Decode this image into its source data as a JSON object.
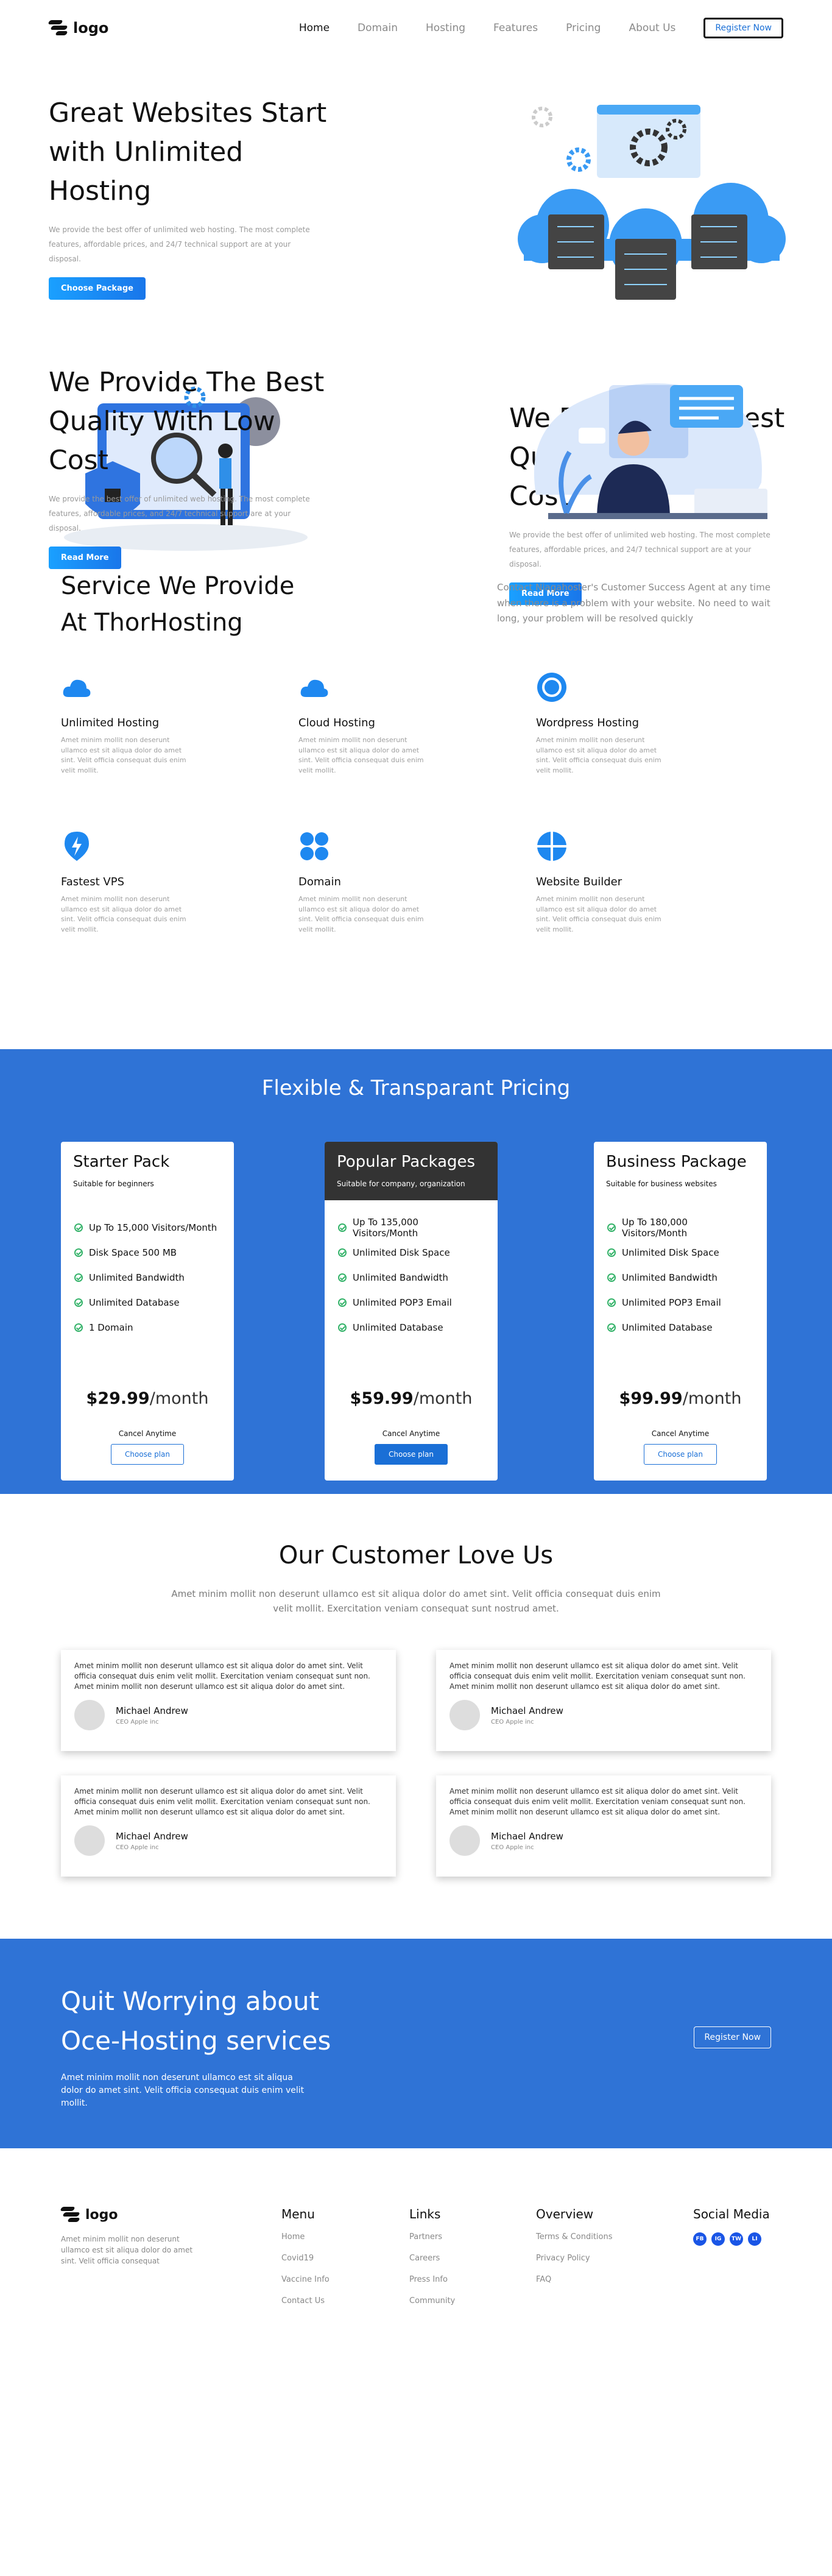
{
  "brand": {
    "logo_text": "logo",
    "accent": "#1a6fd6",
    "primary_blue": "#2f73d6"
  },
  "nav": {
    "items": [
      "Home",
      "Domain",
      "Hosting",
      "Features",
      "Pricing",
      "About Us"
    ],
    "register_label": "Register Now"
  },
  "hero": {
    "title": "Great Websites Start with Unlimited Hosting",
    "text": "We provide the best offer of unlimited web hosting. The most complete features, affordable prices, and 24/7 technical support are at your disposal.",
    "button": "Choose Package"
  },
  "quality1": {
    "title": "We Provide The Best Quality With Low Cost",
    "text": "We provide the best offer of unlimited web hosting. The most complete features, affordable prices, and 24/7 technical support are at your disposal.",
    "button": "Read More"
  },
  "quality2": {
    "title": "We Provide The Best Quality With Low Cost",
    "text": "We provide the best offer of unlimited web hosting. The most complete features, affordable prices, and 24/7 technical support are at your disposal.",
    "button": "Read More"
  },
  "services": {
    "title": "Service We Provide At ThorHosting",
    "subtitle": "Contact Niagahoster's Customer Success Agent at any time when there is a problem with your website. No need to wait long, your problem will be resolved quickly",
    "items": [
      {
        "name": "Unlimited Hosting",
        "icon": "cloud-icon",
        "text": "Amet minim mollit non deserunt ullamco est sit aliqua dolor do amet sint. Velit officia consequat duis enim velit mollit."
      },
      {
        "name": "Cloud Hosting",
        "icon": "cloud-icon",
        "text": "Amet minim mollit non deserunt ullamco est sit aliqua dolor do amet sint. Velit officia consequat duis enim velit mollit."
      },
      {
        "name": "Wordpress Hosting",
        "icon": "wordpress-icon",
        "text": "Amet minim mollit non deserunt ullamco est sit aliqua dolor do amet sint. Velit officia consequat duis enim velit mollit."
      },
      {
        "name": "Fastest VPS",
        "icon": "lightning-icon",
        "text": "Amet minim mollit non deserunt ullamco est sit aliqua dolor do amet sint. Velit officia consequat duis enim velit mollit."
      },
      {
        "name": "Domain",
        "icon": "grid-icon",
        "text": "Amet minim mollit non deserunt ullamco est sit aliqua dolor do amet sint. Velit officia consequat duis enim velit mollit."
      },
      {
        "name": "Website Builder",
        "icon": "pie-icon",
        "text": "Amet minim mollit non deserunt ullamco est sit aliqua dolor do amet sint. Velit officia consequat duis enim velit mollit."
      }
    ]
  },
  "pricing": {
    "title": "Flexible & Transparant Pricing",
    "plans": [
      {
        "name": "Starter Pack",
        "sub": "Suitable for beginners",
        "features": [
          "Up To 15,000 Visitors/Month",
          "Disk Space 500 MB",
          "Unlimited Bandwidth",
          "Unlimited Database",
          "1 Domain"
        ],
        "price": "$29.99",
        "period": "/month",
        "cancel": "Cancel Anytime",
        "button": "Choose plan"
      },
      {
        "name": "Popular Packages",
        "sub": "Suitable for company, organization",
        "features": [
          "Up To 135,000 Visitors/Month",
          "Unlimited Disk Space",
          "Unlimited Bandwidth",
          "Unlimited POP3 Email",
          "Unlimited Database"
        ],
        "price": "$59.99",
        "period": "/month",
        "cancel": "Cancel Anytime",
        "button": "Choose plan"
      },
      {
        "name": "Business Package",
        "sub": "Suitable for business websites",
        "features": [
          "Up To 180,000 Visitors/Month",
          "Unlimited Disk Space",
          "Unlimited Bandwidth",
          "Unlimited POP3 Email",
          "Unlimited Database"
        ],
        "price": "$99.99",
        "period": "/month",
        "cancel": "Cancel Anytime",
        "button": "Choose plan"
      }
    ]
  },
  "testimonials": {
    "title": "Our Customer Love Us",
    "subtitle": "Amet minim mollit non deserunt ullamco est sit aliqua dolor do amet sint. Velit officia consequat duis enim velit mollit. Exercitation veniam consequat sunt nostrud amet.",
    "items": [
      {
        "text": "Amet minim mollit non deserunt ullamco est sit aliqua dolor do amet sint. Velit officia consequat duis enim velit mollit. Exercitation veniam consequat sunt non. Amet minim mollit non deserunt ullamco est sit aliqua dolor do amet sint.",
        "name": "Michael Andrew",
        "role": "CEO Apple inc"
      },
      {
        "text": "Amet minim mollit non deserunt ullamco est sit aliqua dolor do amet sint. Velit officia consequat duis enim velit mollit. Exercitation veniam consequat sunt non. Amet minim mollit non deserunt ullamco est sit aliqua dolor do amet sint.",
        "name": "Michael Andrew",
        "role": "CEO Apple inc"
      },
      {
        "text": "Amet minim mollit non deserunt ullamco est sit aliqua dolor do amet sint. Velit officia consequat duis enim velit mollit. Exercitation veniam consequat sunt non. Amet minim mollit non deserunt ullamco est sit aliqua dolor do amet sint.",
        "name": "Michael Andrew",
        "role": "CEO Apple inc"
      },
      {
        "text": "Amet minim mollit non deserunt ullamco est sit aliqua dolor do amet sint. Velit officia consequat duis enim velit mollit. Exercitation veniam consequat sunt non. Amet minim mollit non deserunt ullamco est sit aliqua dolor do amet sint.",
        "name": "Michael Andrew",
        "role": "CEO Apple inc"
      }
    ]
  },
  "cta": {
    "title": "Quit Worrying about Oce-Hosting services",
    "text": "Amet minim mollit non deserunt ullamco est sit aliqua dolor do amet sint. Velit officia consequat duis enim velit mollit.",
    "button": "Register Now"
  },
  "footer": {
    "logo_text": "logo",
    "about": "Amet minim mollit non deserunt ullamco est sit aliqua dolor do amet sint. Velit officia consequat",
    "menu_title": "Menu",
    "menu": [
      "Home",
      "Covid19",
      "Vaccine Info",
      "Contact Us"
    ],
    "links_title": "Links",
    "links": [
      "Partners",
      "Careers",
      "Press Info",
      "Community"
    ],
    "overview_title": "Overview",
    "overview": [
      "Terms & Conditions",
      "Privacy Policy",
      "FAQ"
    ],
    "social_title": "Social Media",
    "social": [
      "FB",
      "IG",
      "TW",
      "LI"
    ]
  }
}
